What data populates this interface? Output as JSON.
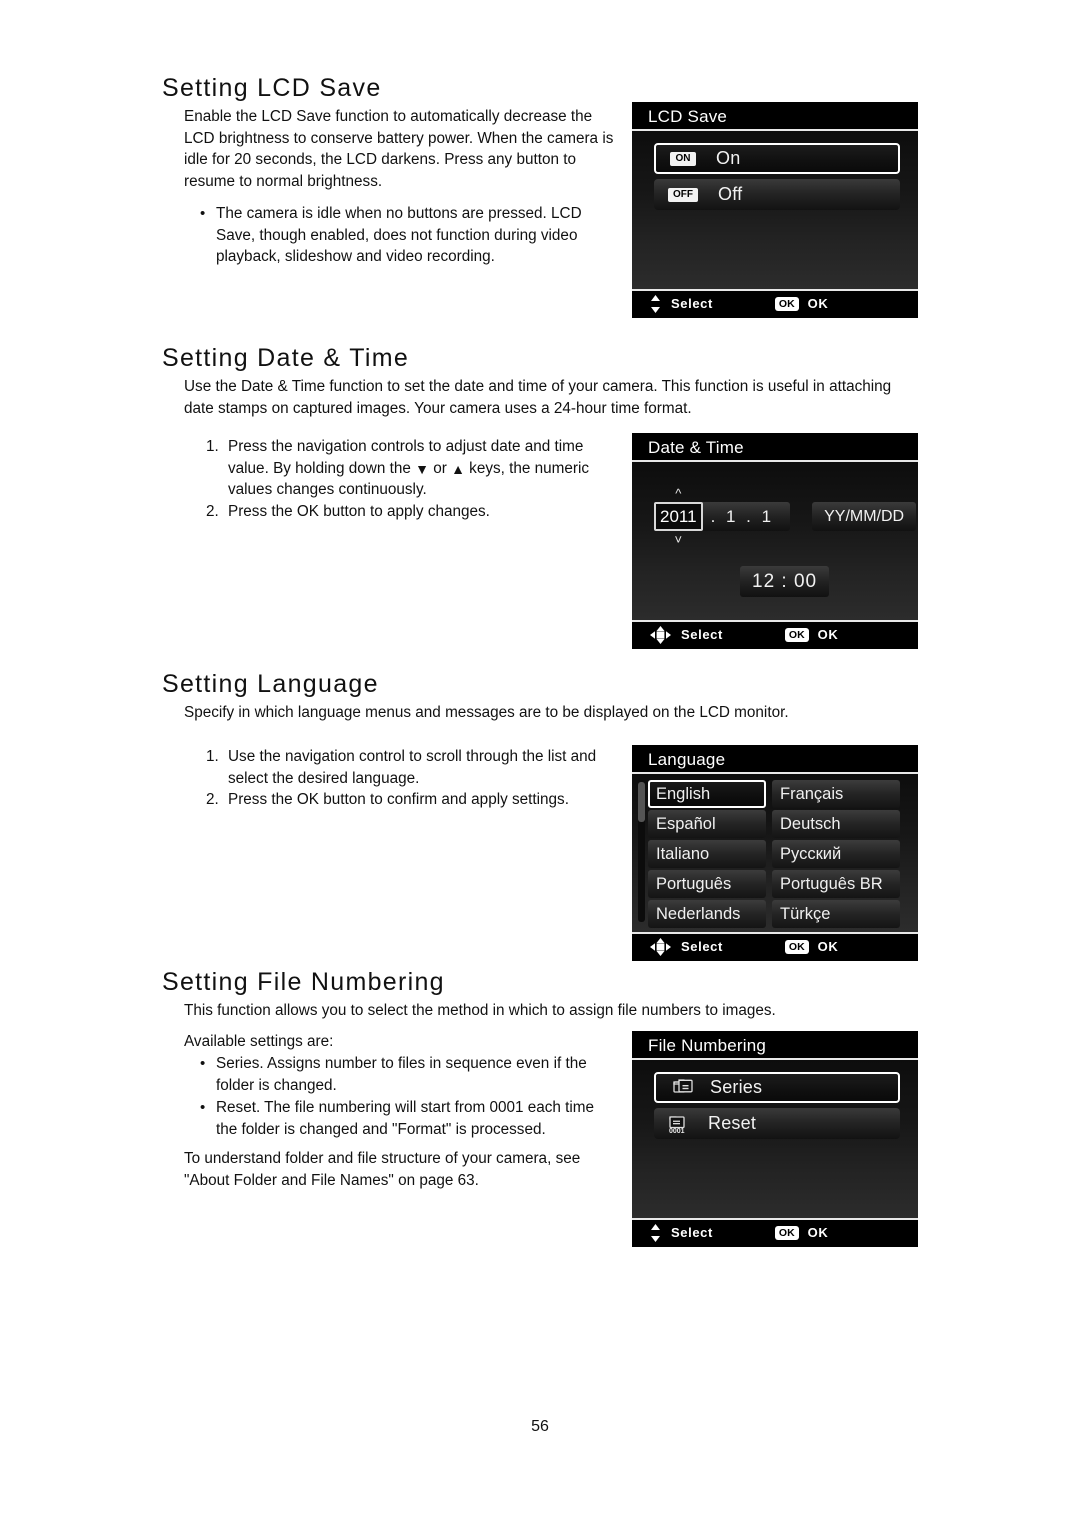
{
  "page": {
    "number": "56"
  },
  "sections": [
    {
      "id": "lcd-save",
      "heading": "Setting LCD Save",
      "paragraph": "Enable the LCD Save function to automatically decrease the LCD brightness to conserve battery power. When the camera is idle for 20 seconds, the LCD darkens. Press any button to resume to normal brightness.",
      "bullets": [
        "The camera is idle when no buttons are pressed. LCD Save, though enabled, does not function during video playback, slideshow and video recording."
      ]
    },
    {
      "id": "date-time",
      "heading": "Setting Date & Time",
      "paragraph": "Use the Date & Time function to set the date and time of your camera. This function is useful in attaching date stamps on captured images. Your camera uses a 24-hour time format.",
      "steps": [
        {
          "number": "1.",
          "text_a": "Press the navigation controls to adjust date and time value. By holding down the ",
          "icon_a": "down-triangle-icon",
          "text_b": " or ",
          "icon_b": "up-triangle-icon",
          "text_c": " keys, the numeric values changes continuously."
        },
        {
          "number": "2.",
          "text_a": "Press the OK button to apply changes."
        }
      ]
    },
    {
      "id": "language",
      "heading": "Setting Language",
      "paragraph": "Specify in which language menus and messages are to be displayed on the LCD monitor.",
      "steps": [
        {
          "number": "1.",
          "text": "Use the navigation control to scroll through the list and select the desired language."
        },
        {
          "number": "2.",
          "text": "Press the OK button to confirm and apply settings."
        }
      ]
    },
    {
      "id": "file-numbering",
      "heading": "Setting File Numbering",
      "paragraph": "This function allows you to select the method in which to assign file numbers to images.",
      "lead_in": "Available settings are:",
      "bullets": [
        "Series. Assigns number to files in sequence even if the folder is changed.",
        "Reset. The file numbering will start from 0001 each time the folder is changed and \"Format\" is processed."
      ],
      "closing": "To understand folder and file structure of your camera, see \"About Folder and File Names\" on page 63."
    }
  ],
  "panels": {
    "lcd_save": {
      "title": "LCD Save",
      "items": [
        {
          "badge": "ON",
          "label": "On",
          "selected": true
        },
        {
          "badge": "OFF",
          "label": "Off",
          "selected": false
        }
      ],
      "footer": {
        "nav_icon": "up-down-arrows-icon",
        "select_label": "Select",
        "ok_badge": "OK",
        "ok_label": "OK"
      }
    },
    "date_time": {
      "title": "Date & Time",
      "year": "2011",
      "month_day": ". 1 . 1",
      "format": "YY/MM/DD",
      "time": "12 : 00",
      "footer": {
        "nav_icon": "four-way-arrows-icon",
        "select_label": "Select",
        "ok_badge": "OK",
        "ok_label": "OK"
      }
    },
    "language": {
      "title": "Language",
      "items": [
        {
          "label": "English",
          "selected": true
        },
        {
          "label": "Français",
          "selected": false
        },
        {
          "label": "Español",
          "selected": false
        },
        {
          "label": "Deutsch",
          "selected": false
        },
        {
          "label": "Italiano",
          "selected": false
        },
        {
          "label": "Русский",
          "selected": false
        },
        {
          "label": "Português",
          "selected": false
        },
        {
          "label": "Português BR",
          "selected": false
        },
        {
          "label": "Nederlands",
          "selected": false
        },
        {
          "label": "Türkçe",
          "selected": false
        }
      ],
      "footer": {
        "nav_icon": "four-way-arrows-icon",
        "select_label": "Select",
        "ok_badge": "OK",
        "ok_label": "OK"
      }
    },
    "file_numbering": {
      "title": "File Numbering",
      "items": [
        {
          "icon": "folders-series-icon",
          "label": "Series",
          "selected": true
        },
        {
          "icon": "folder-0001-icon",
          "label": "Reset",
          "selected": false
        }
      ],
      "footer": {
        "nav_icon": "up-down-arrows-icon",
        "select_label": "Select",
        "ok_badge": "OK",
        "ok_label": "OK"
      }
    }
  },
  "colors": {
    "page_background": "#ffffff",
    "text": "#111111",
    "panel_background": "#000000",
    "panel_text": "#f2f2f2",
    "selection_border": "#ffffff"
  }
}
